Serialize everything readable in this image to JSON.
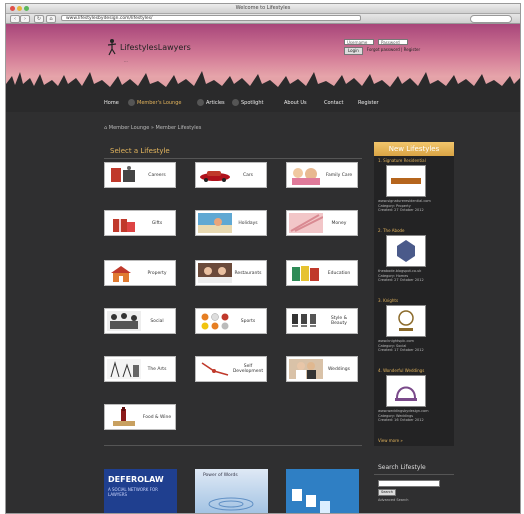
{
  "window": {
    "title": "Welcome to Lifestyles",
    "url": "www.lifestylesbydesign.com/lifestyles/"
  },
  "header": {
    "logo_text": "LifestylesLawyers",
    "tagline": "...",
    "login": {
      "username_placeholder": "Username",
      "password_placeholder": "Password",
      "login_button": "Login",
      "links": "Forgot password | Register"
    }
  },
  "nav": {
    "items": [
      "Home",
      "Member's Lounge",
      "Articles",
      "Spotlight",
      "About Us",
      "Contact",
      "Register"
    ],
    "active": "Member's Lounge"
  },
  "breadcrumb": {
    "first": "Member Lounge",
    "sep": "»",
    "second": "Member Lifestyles"
  },
  "select_title": "Select a Lifestyle",
  "tiles": [
    {
      "label": "Careers"
    },
    {
      "label": "Cars"
    },
    {
      "label": "Family Care"
    },
    {
      "label": "Gifts"
    },
    {
      "label": "Holidays"
    },
    {
      "label": "Money"
    },
    {
      "label": "Property"
    },
    {
      "label": "Restaurants"
    },
    {
      "label": "Education"
    },
    {
      "label": "Social"
    },
    {
      "label": "Sports"
    },
    {
      "label": "Style & Beauty"
    },
    {
      "label": "The Arts"
    },
    {
      "label": "Self Development"
    },
    {
      "label": "Weddings"
    },
    {
      "label": "Food & Wine"
    }
  ],
  "sidebar": {
    "title": "New Lifestyles",
    "items": [
      {
        "title": "1. Signature Residential",
        "meta1": "www.signatureresidential.com",
        "meta2": "Category: Property",
        "meta3": "Created: 27 October 2012"
      },
      {
        "title": "2. The Abode",
        "meta1": "theabode.blogspot.co.uk",
        "meta2": "Category: Homes",
        "meta3": "Created: 27 October 2012"
      },
      {
        "title": "3. Knights",
        "meta1": "www.knightsplc.com",
        "meta2": "Category: Social",
        "meta3": "Created: 17 October 2012"
      },
      {
        "title": "4. Wonderful Weddings",
        "meta1": "www.weddingsbydesign.com",
        "meta2": "Category: Weddings",
        "meta3": "Created: 16 October 2012"
      }
    ],
    "more": "View more »"
  },
  "search_lifestyle": {
    "title": "Search Lifestyle",
    "button": "Search",
    "link": "Advanced Search"
  },
  "ads": {
    "ad1_title": "DEFEROLAW",
    "ad1_sub": "A SOCIAL NETWORK FOR LAWYERS",
    "ad2_title": "Power of Words"
  },
  "colors": {
    "accent": "#e3b45c",
    "background": "#2f2f30",
    "header_pink": "#d27a96"
  }
}
